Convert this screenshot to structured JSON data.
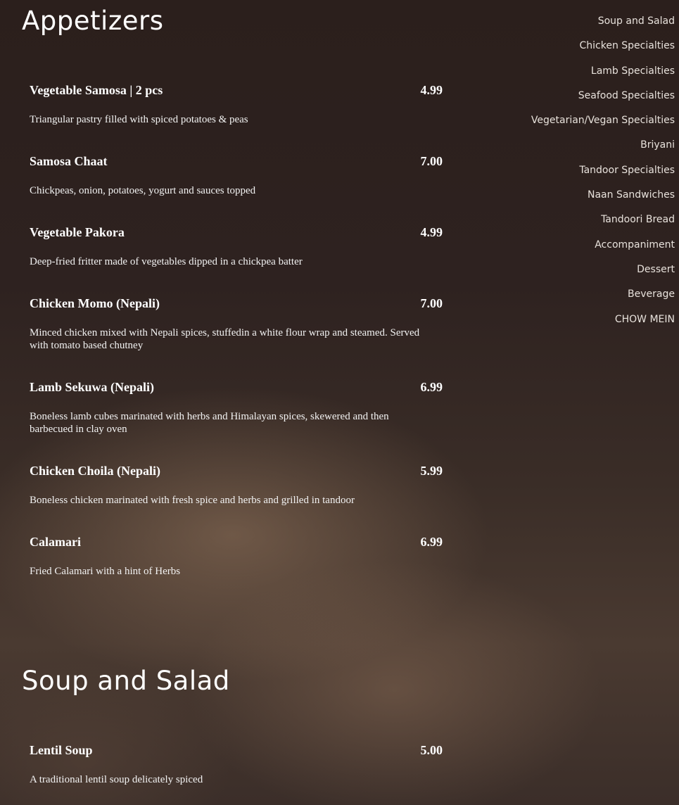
{
  "sections": [
    {
      "title": "Appetizers",
      "items": [
        {
          "name": "Vegetable Samosa | 2 pcs",
          "price": "4.99",
          "description": "Triangular pastry filled with spiced potatoes & peas"
        },
        {
          "name": "Samosa Chaat",
          "price": "7.00",
          "description": "Chickpeas, onion, potatoes, yogurt and sauces topped"
        },
        {
          "name": "Vegetable Pakora",
          "price": "4.99",
          "description": "Deep-fried fritter made of vegetables dipped in a chickpea batter"
        },
        {
          "name": "Chicken Momo (Nepali)",
          "price": "7.00",
          "description": "Minced chicken mixed with Nepali spices, stuffedin a white flour wrap and steamed. Served with tomato based chutney"
        },
        {
          "name": "Lamb Sekuwa (Nepali)",
          "price": "6.99",
          "description": "Boneless lamb cubes marinated with herbs and Himalayan spices, skewered and then barbecued in clay oven"
        },
        {
          "name": "Chicken Choila (Nepali)",
          "price": "5.99",
          "description": "Boneless chicken marinated with fresh spice and herbs and grilled in tandoor"
        },
        {
          "name": "Calamari",
          "price": "6.99",
          "description": "Fried Calamari with a hint of Herbs"
        }
      ]
    },
    {
      "title": "Soup and Salad",
      "items": [
        {
          "name": "Lentil Soup",
          "price": "5.00",
          "description": "A traditional lentil soup delicately spiced"
        }
      ]
    }
  ],
  "nav": [
    "Soup and Salad",
    "Chicken Specialties",
    "Lamb Specialties",
    "Seafood Specialties",
    "Vegetarian/Vegan Specialties",
    "Briyani",
    "Tandoor Specialties",
    "Naan Sandwiches",
    "Tandoori Bread",
    "Accompaniment",
    "Dessert",
    "Beverage",
    "CHOW MEIN"
  ]
}
